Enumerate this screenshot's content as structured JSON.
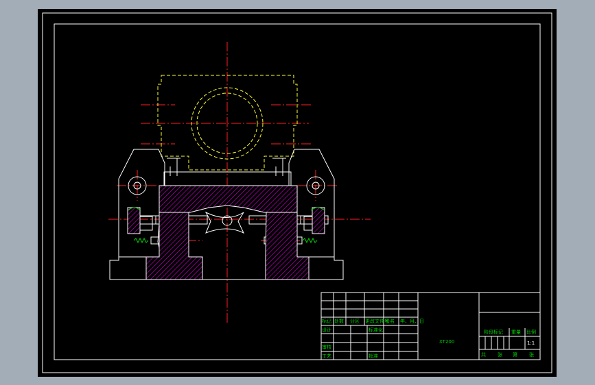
{
  "drawing": {
    "title_block": {
      "row_labels": [
        "标记",
        "处数",
        "分区",
        "更改文件号",
        "签名",
        "年、月、日"
      ],
      "design": "设计",
      "standardization": "标准化",
      "review": "审核",
      "process": "工艺",
      "approve": "批准",
      "drawing_name": "XT200",
      "stage_mark": "阶段标记",
      "weight": "重量",
      "scale_label": "比例",
      "scale": "1:1",
      "sheets_total": "共",
      "sheet_unit": "张",
      "sheet_no": "第",
      "sheet_unit2": "张"
    },
    "colors": {
      "background": "#000000",
      "window": "#a3adb8",
      "outline": "#ffffff",
      "centerline": "#ff2020",
      "phantom": "#ffff30",
      "hatch": "#c000c0",
      "text": "#00d000"
    }
  }
}
